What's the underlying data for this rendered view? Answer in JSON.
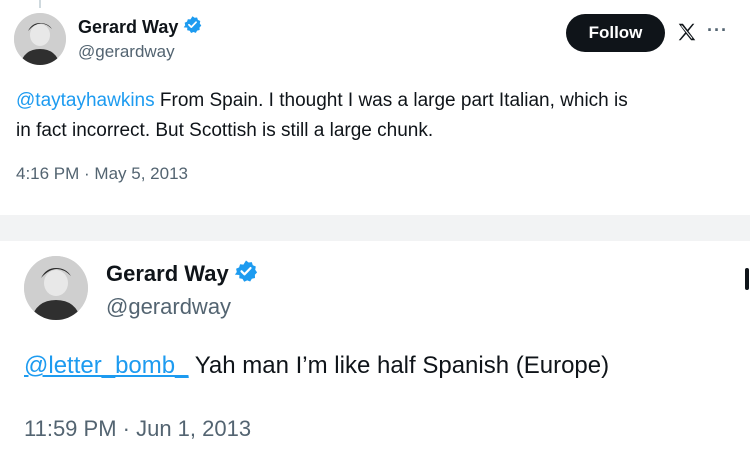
{
  "tweet1": {
    "name": "Gerard Way",
    "handle": "@gerardway",
    "follow_label": "Follow",
    "mention": "@taytayhawkins",
    "text_line1": " From Spain. I thought I was a large part Italian, which is",
    "text_line2": "in fact incorrect. But Scottish is still a large chunk.",
    "timestamp": "4:16 PM · May 5, 2013"
  },
  "tweet2": {
    "name": "Gerard Way",
    "handle": "@gerardway",
    "mention": "@letter_bomb_",
    "text": " Yah man I’m like half Spanish (Europe)",
    "timestamp": "11:59 PM · Jun 1, 2013"
  },
  "icons": {
    "verified": "verified-badge-icon",
    "logo": "x-logo-icon",
    "more": "more-options-icon"
  },
  "colors": {
    "link": "#1d9bf0",
    "verified": "#1d9bf0",
    "secondary_text": "#536471",
    "follow_button": "#0f1419"
  }
}
